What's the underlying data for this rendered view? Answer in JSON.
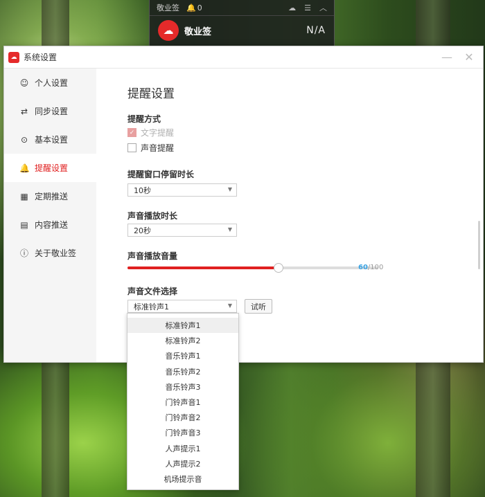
{
  "mini_widget": {
    "title": "敬业签",
    "notify_count": "0",
    "account_name": "敬业签",
    "value": "N/A"
  },
  "window": {
    "title": "系统设置"
  },
  "sidebar": {
    "items": [
      {
        "label": "个人设置",
        "icon": "user-icon"
      },
      {
        "label": "同步设置",
        "icon": "sync-icon"
      },
      {
        "label": "基本设置",
        "icon": "settings-icon"
      },
      {
        "label": "提醒设置",
        "icon": "bell-icon",
        "active": true
      },
      {
        "label": "定期推送",
        "icon": "calendar-icon"
      },
      {
        "label": "内容推送",
        "icon": "document-icon"
      },
      {
        "label": "关于敬业签",
        "icon": "info-icon"
      }
    ]
  },
  "content": {
    "page_title": "提醒设置",
    "reminder_method": {
      "label": "提醒方式",
      "options": [
        {
          "label": "文字提醒",
          "checked": true,
          "disabled": true
        },
        {
          "label": "声音提醒",
          "checked": false
        }
      ]
    },
    "window_duration": {
      "label": "提醒窗口停留时长",
      "value": "10秒"
    },
    "play_duration": {
      "label": "声音播放时长",
      "value": "20秒"
    },
    "volume": {
      "label": "声音播放音量",
      "value": 60,
      "max": "100",
      "value_text": "60",
      "max_text": "/100"
    },
    "sound_file": {
      "label": "声音文件选择",
      "value": "标准铃声1",
      "test_button": "试听",
      "options": [
        "标准铃声1",
        "标准铃声2",
        "音乐铃声1",
        "音乐铃声2",
        "音乐铃声3",
        "门铃声音1",
        "门铃声音2",
        "门铃声音3",
        "人声提示1",
        "人声提示2",
        "机场提示音"
      ]
    }
  },
  "colors": {
    "accent": "#e02020",
    "volume_text": "#3aa3e3"
  }
}
